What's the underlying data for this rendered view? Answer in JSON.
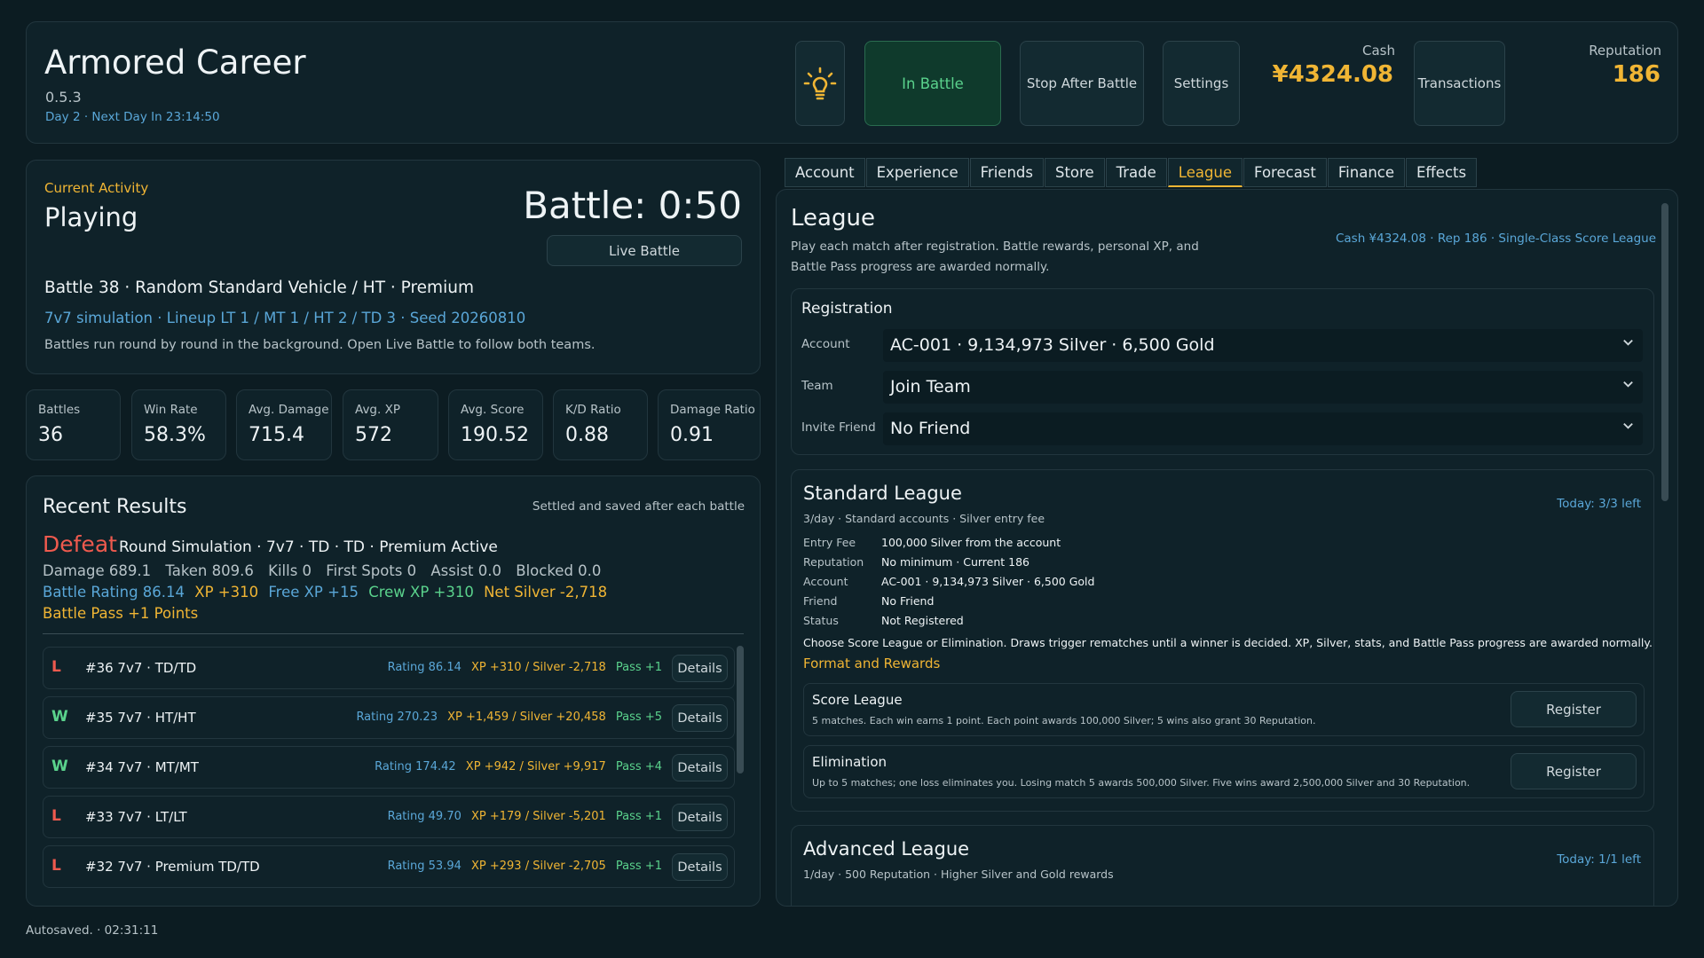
{
  "header": {
    "title": "Armored Career",
    "version": "0.5.3",
    "day": "Day 2 · Next Day In 23:14:50",
    "status_button": "In Battle",
    "stop_button": "Stop After Battle",
    "settings_button": "Settings",
    "cash_label": "Cash",
    "cash_value": "¥4324.08",
    "transactions_button": "Transactions",
    "reputation_label": "Reputation",
    "reputation_value": "186"
  },
  "activity": {
    "label": "Current Activity",
    "state": "Playing",
    "timer": "Battle: 0:50",
    "live_button": "Live Battle",
    "line1": "Battle 38 · Random Standard Vehicle / HT · Premium",
    "line2": "7v7 simulation · Lineup LT 1 / MT 1 / HT 2 / TD 3 · Seed 20260810",
    "line3": "Battles run round by round in the background. Open Live Battle to follow both teams."
  },
  "stats": [
    {
      "label": "Battles",
      "value": "36"
    },
    {
      "label": "Win Rate",
      "value": "58.3%"
    },
    {
      "label": "Avg. Damage",
      "value": "715.4"
    },
    {
      "label": "Avg. XP",
      "value": "572"
    },
    {
      "label": "Avg. Score",
      "value": "190.52"
    },
    {
      "label": "K/D Ratio",
      "value": "0.88"
    },
    {
      "label": "Damage Ratio",
      "value": "0.91"
    }
  ],
  "recent": {
    "title": "Recent Results",
    "note": "Settled and saved after each battle",
    "result": "Defeat",
    "subtitle": "Round Simulation · 7v7 · TD · TD · Premium Active",
    "stats": [
      "Damage 689.1",
      "Taken 809.6",
      "Kills 0",
      "First Spots 0",
      "Assist 0.0",
      "Blocked 0.0"
    ],
    "gains": {
      "rating": "Battle Rating 86.14",
      "xp": "XP +310",
      "free_xp": "Free XP +15",
      "crew_xp": "Crew XP +310",
      "silver": "Net Silver -2,718"
    },
    "pass": "Battle Pass +1 Points",
    "rows": [
      {
        "result": "L",
        "title": "#36  7v7 · TD/TD",
        "rating": "Rating 86.14",
        "xp": "XP +310 / Silver -2,718",
        "pass": "Pass +1",
        "details": "Details"
      },
      {
        "result": "W",
        "title": "#35  7v7 · HT/HT",
        "rating": "Rating 270.23",
        "xp": "XP +1,459 / Silver +20,458",
        "pass": "Pass +5",
        "details": "Details"
      },
      {
        "result": "W",
        "title": "#34  7v7 · MT/MT",
        "rating": "Rating 174.42",
        "xp": "XP +942 / Silver +9,917",
        "pass": "Pass +4",
        "details": "Details"
      },
      {
        "result": "L",
        "title": "#33  7v7 · LT/LT",
        "rating": "Rating 49.70",
        "xp": "XP +179 / Silver -5,201",
        "pass": "Pass +1",
        "details": "Details"
      },
      {
        "result": "L",
        "title": "#32  7v7 · Premium TD/TD",
        "rating": "Rating 53.94",
        "xp": "XP +293 / Silver -2,705",
        "pass": "Pass +1",
        "details": "Details"
      }
    ]
  },
  "autosave": "Autosaved.  ·  02:31:11",
  "tabs": [
    "Account",
    "Experience",
    "Friends",
    "Store",
    "Trade",
    "League",
    "Forecast",
    "Finance",
    "Effects"
  ],
  "active_tab": "League",
  "league": {
    "title": "League",
    "description": "Play each match after registration. Battle rewards, personal XP, and Battle Pass progress are awarded normally.",
    "summary": "Cash ¥4324.08 · Rep 186 · Single-Class Score League",
    "registration": {
      "title": "Registration",
      "account_label": "Account",
      "account_value": "AC-001 · 9,134,973 Silver · 6,500 Gold",
      "team_label": "Team",
      "team_value": "Join Team",
      "friend_label": "Invite Friend",
      "friend_value": "No Friend"
    },
    "standard": {
      "title": "Standard League",
      "subtitle": "3/day · Standard accounts · Silver entry fee",
      "today": "Today: 3/3 left",
      "fields": [
        {
          "label": "Entry Fee",
          "value": "100,000 Silver from the account"
        },
        {
          "label": "Reputation",
          "value": "No minimum · Current 186"
        },
        {
          "label": "Account",
          "value": "AC-001 · 9,134,973 Silver · 6,500 Gold"
        },
        {
          "label": "Friend",
          "value": "No Friend"
        },
        {
          "label": "Status",
          "value": "Not Registered"
        }
      ],
      "note": "Choose Score League or Elimination. Draws trigger rematches until a winner is decided. XP, Silver, stats, and Battle Pass progress are awarded normally.",
      "format_label": "Format and Rewards",
      "options": [
        {
          "title": "Score League",
          "desc": "5 matches. Each win earns 1 point. Each point awards 100,000 Silver; 5 wins also grant 30 Reputation.",
          "button": "Register"
        },
        {
          "title": "Elimination",
          "desc": "Up to 5 matches; one loss eliminates you. Losing match 5 awards 500,000 Silver. Five wins award 2,500,000 Silver and 30 Reputation.",
          "button": "Register"
        }
      ]
    },
    "advanced": {
      "title": "Advanced League",
      "subtitle": "1/day · 500 Reputation · Higher Silver and Gold rewards",
      "today": "Today: 1/1 left"
    }
  },
  "colors": {
    "accent_gold": "#f0b534",
    "accent_blue": "#5aa7d8",
    "win_green": "#5ad28c",
    "loss_red": "#ef5a4e",
    "background": "#0c1c22"
  },
  "icons": {
    "status_icon": "lightbulb-icon",
    "select_icon": "chevron-down-icon"
  }
}
